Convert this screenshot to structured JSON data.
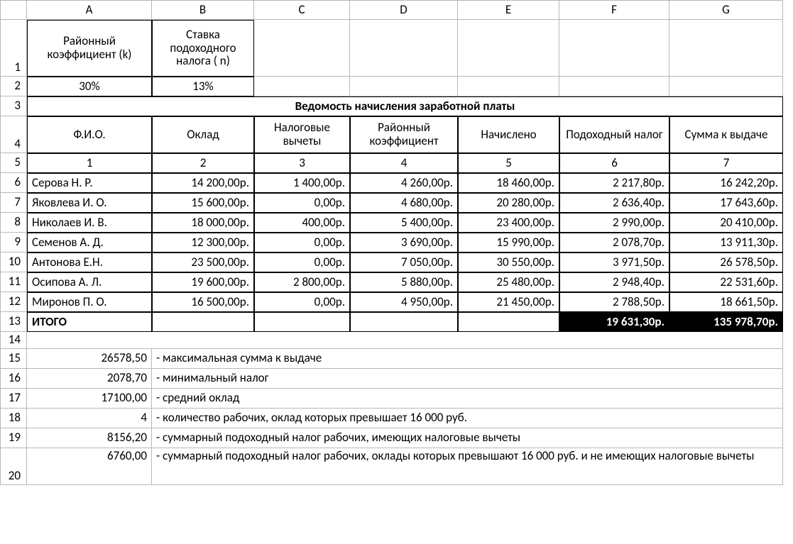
{
  "cols": [
    "A",
    "B",
    "C",
    "D",
    "E",
    "F",
    "G"
  ],
  "rows": [
    "1",
    "2",
    "3",
    "4",
    "5",
    "6",
    "7",
    "8",
    "9",
    "10",
    "11",
    "12",
    "13",
    "14",
    "15",
    "16",
    "17",
    "18",
    "19",
    "20"
  ],
  "hdrA": "Районный коэффициент (k)",
  "hdrB": "Ставка подоходного налога ( n)",
  "valA": "30%",
  "valB": "13%",
  "title": "Ведомость начисления заработной платы",
  "th": {
    "a": "Ф.И.О.",
    "b": "Оклад",
    "c": "Налоговые вычеты",
    "d": "Районный коэффициент",
    "e": "Начислено",
    "f": "Подоходный налог",
    "g": "Сумма к выдаче"
  },
  "nums": {
    "a": "1",
    "b": "2",
    "c": "3",
    "d": "4",
    "e": "5",
    "f": "6",
    "g": "7"
  },
  "r6": {
    "a": "Серова Н. Р.",
    "b": "14 200,00р.",
    "c": "1 400,00р.",
    "d": "4 260,00р.",
    "e": "18 460,00р.",
    "f": "2 217,80р.",
    "g": "16 242,20р."
  },
  "r7": {
    "a": "Яковлева И. О.",
    "b": "15 600,00р.",
    "c": "0,00р.",
    "d": "4 680,00р.",
    "e": "20 280,00р.",
    "f": "2 636,40р.",
    "g": "17 643,60р."
  },
  "r8": {
    "a": "Николаев И. В.",
    "b": "18 000,00р.",
    "c": "400,00р.",
    "d": "5 400,00р.",
    "e": "23 400,00р.",
    "f": "2 990,00р.",
    "g": "20 410,00р."
  },
  "r9": {
    "a": "Семенов А. Д.",
    "b": "12 300,00р.",
    "c": "0,00р.",
    "d": "3 690,00р.",
    "e": "15 990,00р.",
    "f": "2 078,70р.",
    "g": "13 911,30р."
  },
  "r10": {
    "a": "Антонова Е.Н.",
    "b": "23 500,00р.",
    "c": "0,00р.",
    "d": "7 050,00р.",
    "e": "30 550,00р.",
    "f": "3 971,50р.",
    "g": "26 578,50р."
  },
  "r11": {
    "a": "Осипова А. Л.",
    "b": "19 600,00р.",
    "c": "2 800,00р.",
    "d": "5 880,00р.",
    "e": "25 480,00р.",
    "f": "2 948,40р.",
    "g": "22 531,60р."
  },
  "r12": {
    "a": "Миронов П. О.",
    "b": "16 500,00р.",
    "c": "0,00р.",
    "d": "4 950,00р.",
    "e": "21 450,00р.",
    "f": "2 788,50р.",
    "g": "18 661,50р."
  },
  "total_label": "ИТОГО",
  "total_f": "19 631,30р.",
  "total_g": "135 978,70р.",
  "s15a": "26578,50",
  "s15b": "- максимальная сумма к выдаче",
  "s16a": "2078,70",
  "s16b": "- минимальный налог",
  "s17a": "17100,00",
  "s17b": "- средний оклад",
  "s18a": "4",
  "s18b": "- количество рабочих, оклад которых превышает 16 000 руб.",
  "s19a": "8156,20",
  "s19b": "- суммарный подоходный налог рабочих, имеющих налоговые вычеты",
  "s20a": "6760,00",
  "s20b": "- суммарный подоходный налог рабочих, оклады которых превышают 16 000 руб. и не имеющих налоговые вычеты"
}
